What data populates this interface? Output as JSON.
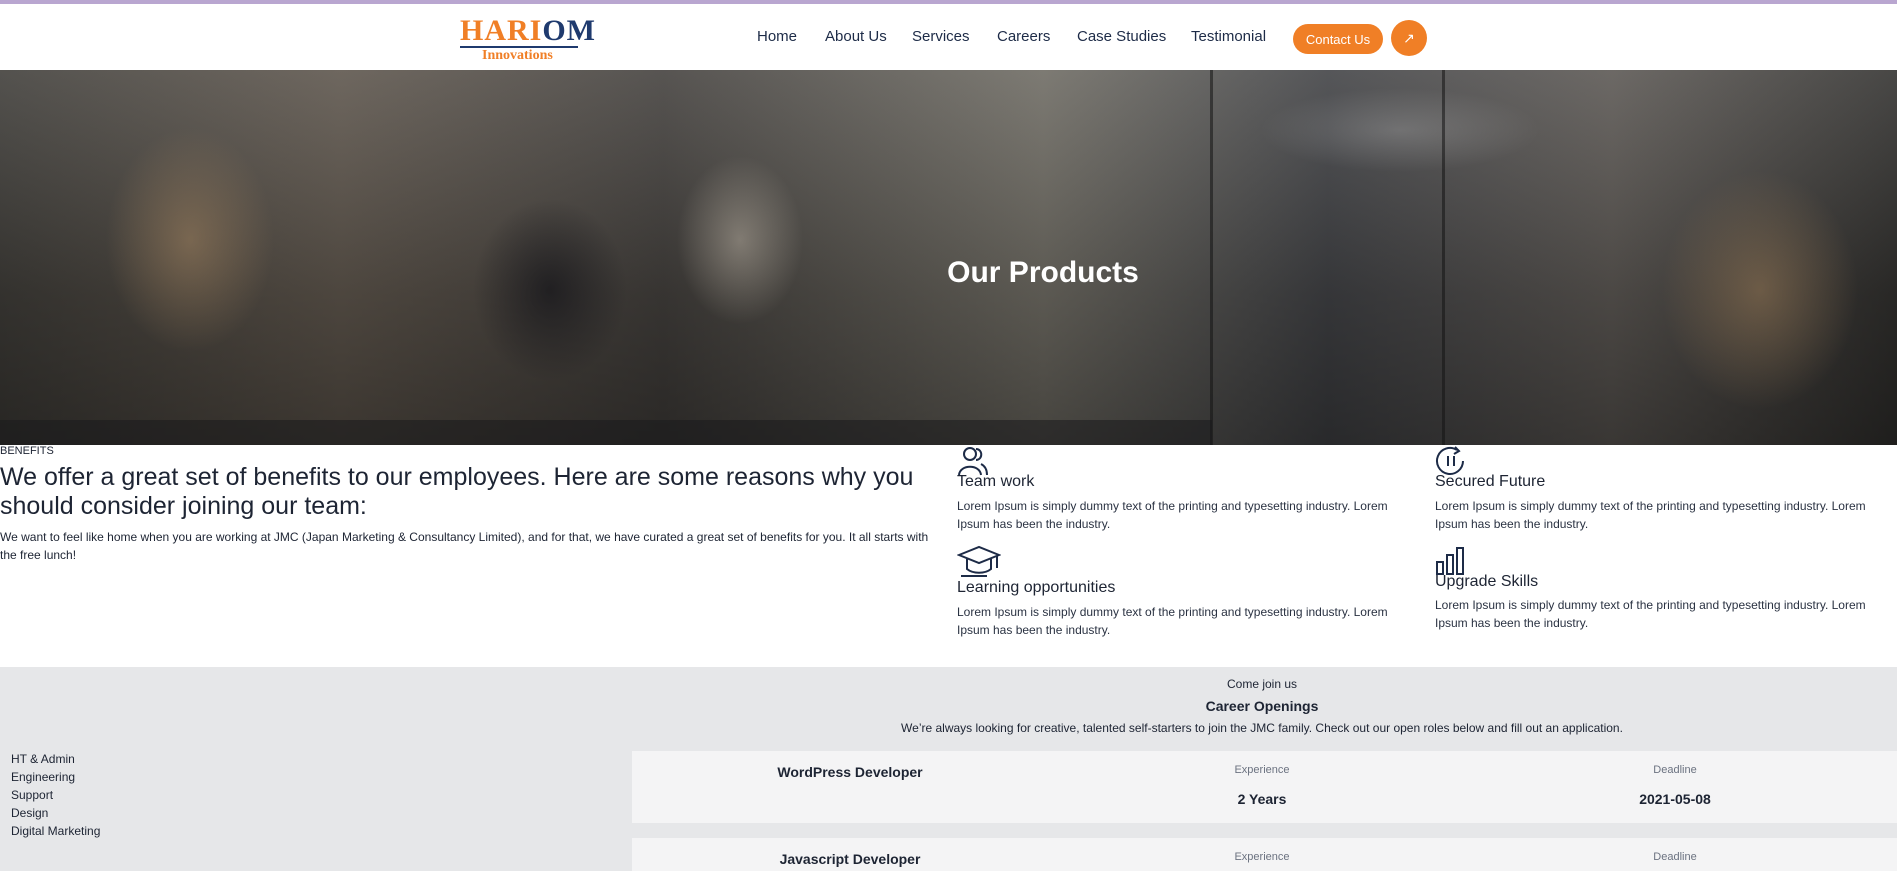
{
  "brand": {
    "logo_main": "HARI",
    "logo_om": "OM",
    "logo_sub": "Innovations",
    "color": "#f07f26"
  },
  "nav": {
    "items": [
      "Home",
      "About Us",
      "Services",
      "Careers",
      "Case Studies",
      "Testimonial"
    ],
    "contact_label": "Contact Us",
    "arrow_icon": "↗"
  },
  "hero": {
    "title": "Our Products"
  },
  "benefits": {
    "label": "BENEFITS",
    "heading": "We offer a great set of benefits to our employees. Here are some reasons why you should consider joining our team:",
    "text": "We want to feel like home when you are working at JMC (Japan Marketing & Consultancy Limited), and for that, we have curated a great set of benefits for you. It all starts with the free lunch!",
    "items": [
      {
        "icon": "team-icon",
        "title": "Team work",
        "desc": "Lorem Ipsum is simply dummy text of the printing and typesetting industry. Lorem Ipsum has been the industry."
      },
      {
        "icon": "secured-future-icon",
        "title": "Secured Future",
        "desc": "Lorem Ipsum is simply dummy text of the printing and typesetting industry. Lorem Ipsum has been the industry."
      },
      {
        "icon": "graduation-cap-icon",
        "title": "Learning opportunities",
        "desc": "Lorem Ipsum is simply dummy text of the printing and typesetting industry. Lorem Ipsum has been the industry."
      },
      {
        "icon": "bar-chart-icon",
        "title": "Upgrade Skills",
        "desc": "Lorem Ipsum is simply dummy text of the printing and typesetting industry. Lorem Ipsum has been the industry."
      }
    ]
  },
  "careers": {
    "small": "Come join us",
    "title": "Career Openings",
    "text": "We’re always looking for creative, talented self-starters to join the JMC family. Check out our open roles below and fill out an application.",
    "departments": [
      "HT & Admin",
      "Engineering",
      "Support",
      "Design",
      "Digital Marketing"
    ],
    "jobs": [
      {
        "title": "WordPress Developer",
        "experience_label": "Experience",
        "experience": "2 Years",
        "deadline_label": "Deadline",
        "deadline": "2021-05-08"
      },
      {
        "title": "Javascript Developer",
        "experience_label": "Experience",
        "experience": "",
        "deadline_label": "Deadline",
        "deadline": ""
      }
    ]
  }
}
